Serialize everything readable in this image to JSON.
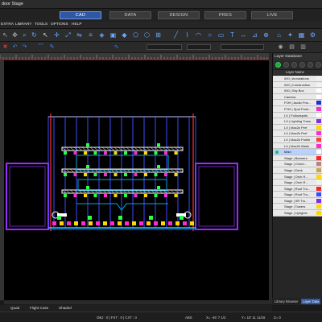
{
  "window": {
    "title": "door Stage"
  },
  "modes": [
    {
      "label": "CAD",
      "active": true
    },
    {
      "label": "DATA",
      "active": false
    },
    {
      "label": "DESIGN",
      "active": false
    },
    {
      "label": "PRES",
      "active": false
    },
    {
      "label": "LIVE",
      "active": false
    }
  ],
  "menu": [
    "EXTRA",
    "LIBRARY",
    "TOOLS",
    "OPTIONS",
    "HELP"
  ],
  "layer_panel": {
    "title": "Layer Database",
    "column_header": "Layer Name",
    "layers": [
      {
        "name": "000 | Annotations",
        "color": "#f2f2f2",
        "visible": false
      },
      {
        "name": "000 | Construction",
        "color": "#f2f2f2",
        "visible": false
      },
      {
        "name": "000 | Sky Box",
        "color": "#ffffff",
        "visible": false
      },
      {
        "name": "Camera",
        "color": "#ffffff",
        "visible": false
      },
      {
        "name": "FOH | Audio Pos...",
        "color": "#2a2ad8",
        "visible": false
      },
      {
        "name": "FOH | Spot Posit...",
        "color": "#ff2ad0",
        "visible": false
      },
      {
        "name": "LX | Followspots",
        "color": "#ffffff",
        "visible": false
      },
      {
        "name": "LX | Lighting Truss",
        "color": "#8a2be2",
        "visible": false
      },
      {
        "name": "LX | Mac2k Perf",
        "color": "#ffd800",
        "visible": false
      },
      {
        "name": "LX | Mac2k Perf",
        "color": "#ff2ad0",
        "visible": false
      },
      {
        "name": "LX | Mac2k Profile",
        "color": "#ff4040",
        "visible": false
      },
      {
        "name": "LX | Mac2k Wash",
        "color": "#ff2ad0",
        "visible": false
      },
      {
        "name": "Main",
        "color": "#ffffff",
        "visible": true
      },
      {
        "name": "Stage | Banners",
        "color": "#ff2020",
        "visible": false
      },
      {
        "name": "Stage | Chord...",
        "color": "#c08080",
        "visible": false
      },
      {
        "name": "Stage | Deck",
        "color": "#d0a050",
        "visible": false
      },
      {
        "name": "Stage | Orch R...",
        "color": "#ffd800",
        "visible": false
      },
      {
        "name": "Stage | Orch R...",
        "color": "#f2f2f2",
        "visible": false
      },
      {
        "name": "Stage | Roof Tru...",
        "color": "#ff2020",
        "visible": false
      },
      {
        "name": "Stage | Roof Tru...",
        "color": "#3050ff",
        "visible": false
      },
      {
        "name": "Stage | SR Tru...",
        "color": "#8a2be2",
        "visible": false
      },
      {
        "name": "Stage | Towers",
        "color": "#ffd800",
        "visible": false
      },
      {
        "name": "Stage | Uprights",
        "color": "#ffd800",
        "visible": false
      }
    ]
  },
  "panel_tabs": [
    "Library Browser",
    "Layer Data"
  ],
  "view_tabs": [
    "Quad",
    "Flight Case",
    "Shaded"
  ],
  "status": {
    "obj": "OBJ : 0 | FXT : 0 | CXT : 0",
    "abs": "ABS",
    "x": "X= -45' 7 1/2",
    "y": "Y= 10' 11 11/16",
    "z": "Z= 0"
  },
  "colors": {
    "accent": "#2f57a3",
    "truss_line": "#3a4cff",
    "wing_outline": "#9b2cff",
    "deck_cyan": "#00d8ff",
    "fixture_green": "#2bff45",
    "fixture_magenta": "#ff2ad0"
  },
  "icons": [
    "select-icon",
    "zoom-icon",
    "pan-icon",
    "rotate-icon",
    "cube-icon",
    "layer-icon",
    "settings-icon",
    "grid-icon",
    "camera-icon",
    "render-icon"
  ]
}
